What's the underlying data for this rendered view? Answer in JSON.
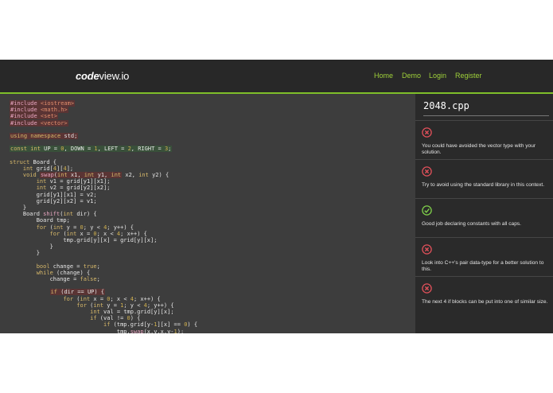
{
  "nav": {
    "logo_strong": "code",
    "logo_light": "view.io",
    "links": [
      "Home",
      "Demo",
      "Login",
      "Register"
    ]
  },
  "file": {
    "name": "2048.cpp"
  },
  "code_lines": [
    "#include <iostream>",
    "#include <math.h>",
    "#include <set>",
    "#include <vector>",
    "",
    "using namespace std;",
    "",
    "const int UP = 0, DOWN = 1, LEFT = 2, RIGHT = 3;",
    "",
    "struct Board {",
    "    int grid[4][4];",
    "    void swap(int x1, int y1, int x2, int y2) {",
    "        int v1 = grid[y1][x1];",
    "        int v2 = grid[y2][x2];",
    "        grid[y1][x1] = v2;",
    "        grid[y2][x2] = v1;",
    "    }",
    "    Board shift(int dir) {",
    "        Board tmp;",
    "        for (int y = 0; y < 4; y++) {",
    "            for (int x = 0; x < 4; x++) {",
    "                tmp.grid[y][x] = grid[y][x];",
    "            }",
    "        }",
    "",
    "        bool change = true;",
    "        while (change) {",
    "            change = false;",
    "",
    "            if (dir == UP) {",
    "                for (int x = 0; x < 4; x++) {",
    "                    for (int y = 1; y < 4; y++) {",
    "                        int val = tmp.grid[y][x];",
    "                        if (val != 0) {",
    "                            if (tmp.grid[y-1][x] == 0) {",
    "                                tmp.swap(x,y,x,y-1);"
  ],
  "feedback": [
    {
      "status": "error",
      "icon": "x-circle-icon",
      "text": "You could have avoided the vector type with your solution."
    },
    {
      "status": "error",
      "icon": "x-circle-icon",
      "text": "Try to avoid using the standard library in this context."
    },
    {
      "status": "success",
      "icon": "check-circle-icon",
      "text": "Good job declaring constants with all caps."
    },
    {
      "status": "error",
      "icon": "x-circle-icon",
      "text": "Look into C++'s pair data-type for a better solution to this."
    },
    {
      "status": "error",
      "icon": "x-circle-icon",
      "text": "The next 4 if blocks can be put into one of similar size."
    }
  ],
  "colors": {
    "accent": "#9fd13a",
    "error": "#e0505a",
    "success": "#7fcf4a",
    "highlight_red": "#5a3434",
    "highlight_green": "#39503a"
  }
}
